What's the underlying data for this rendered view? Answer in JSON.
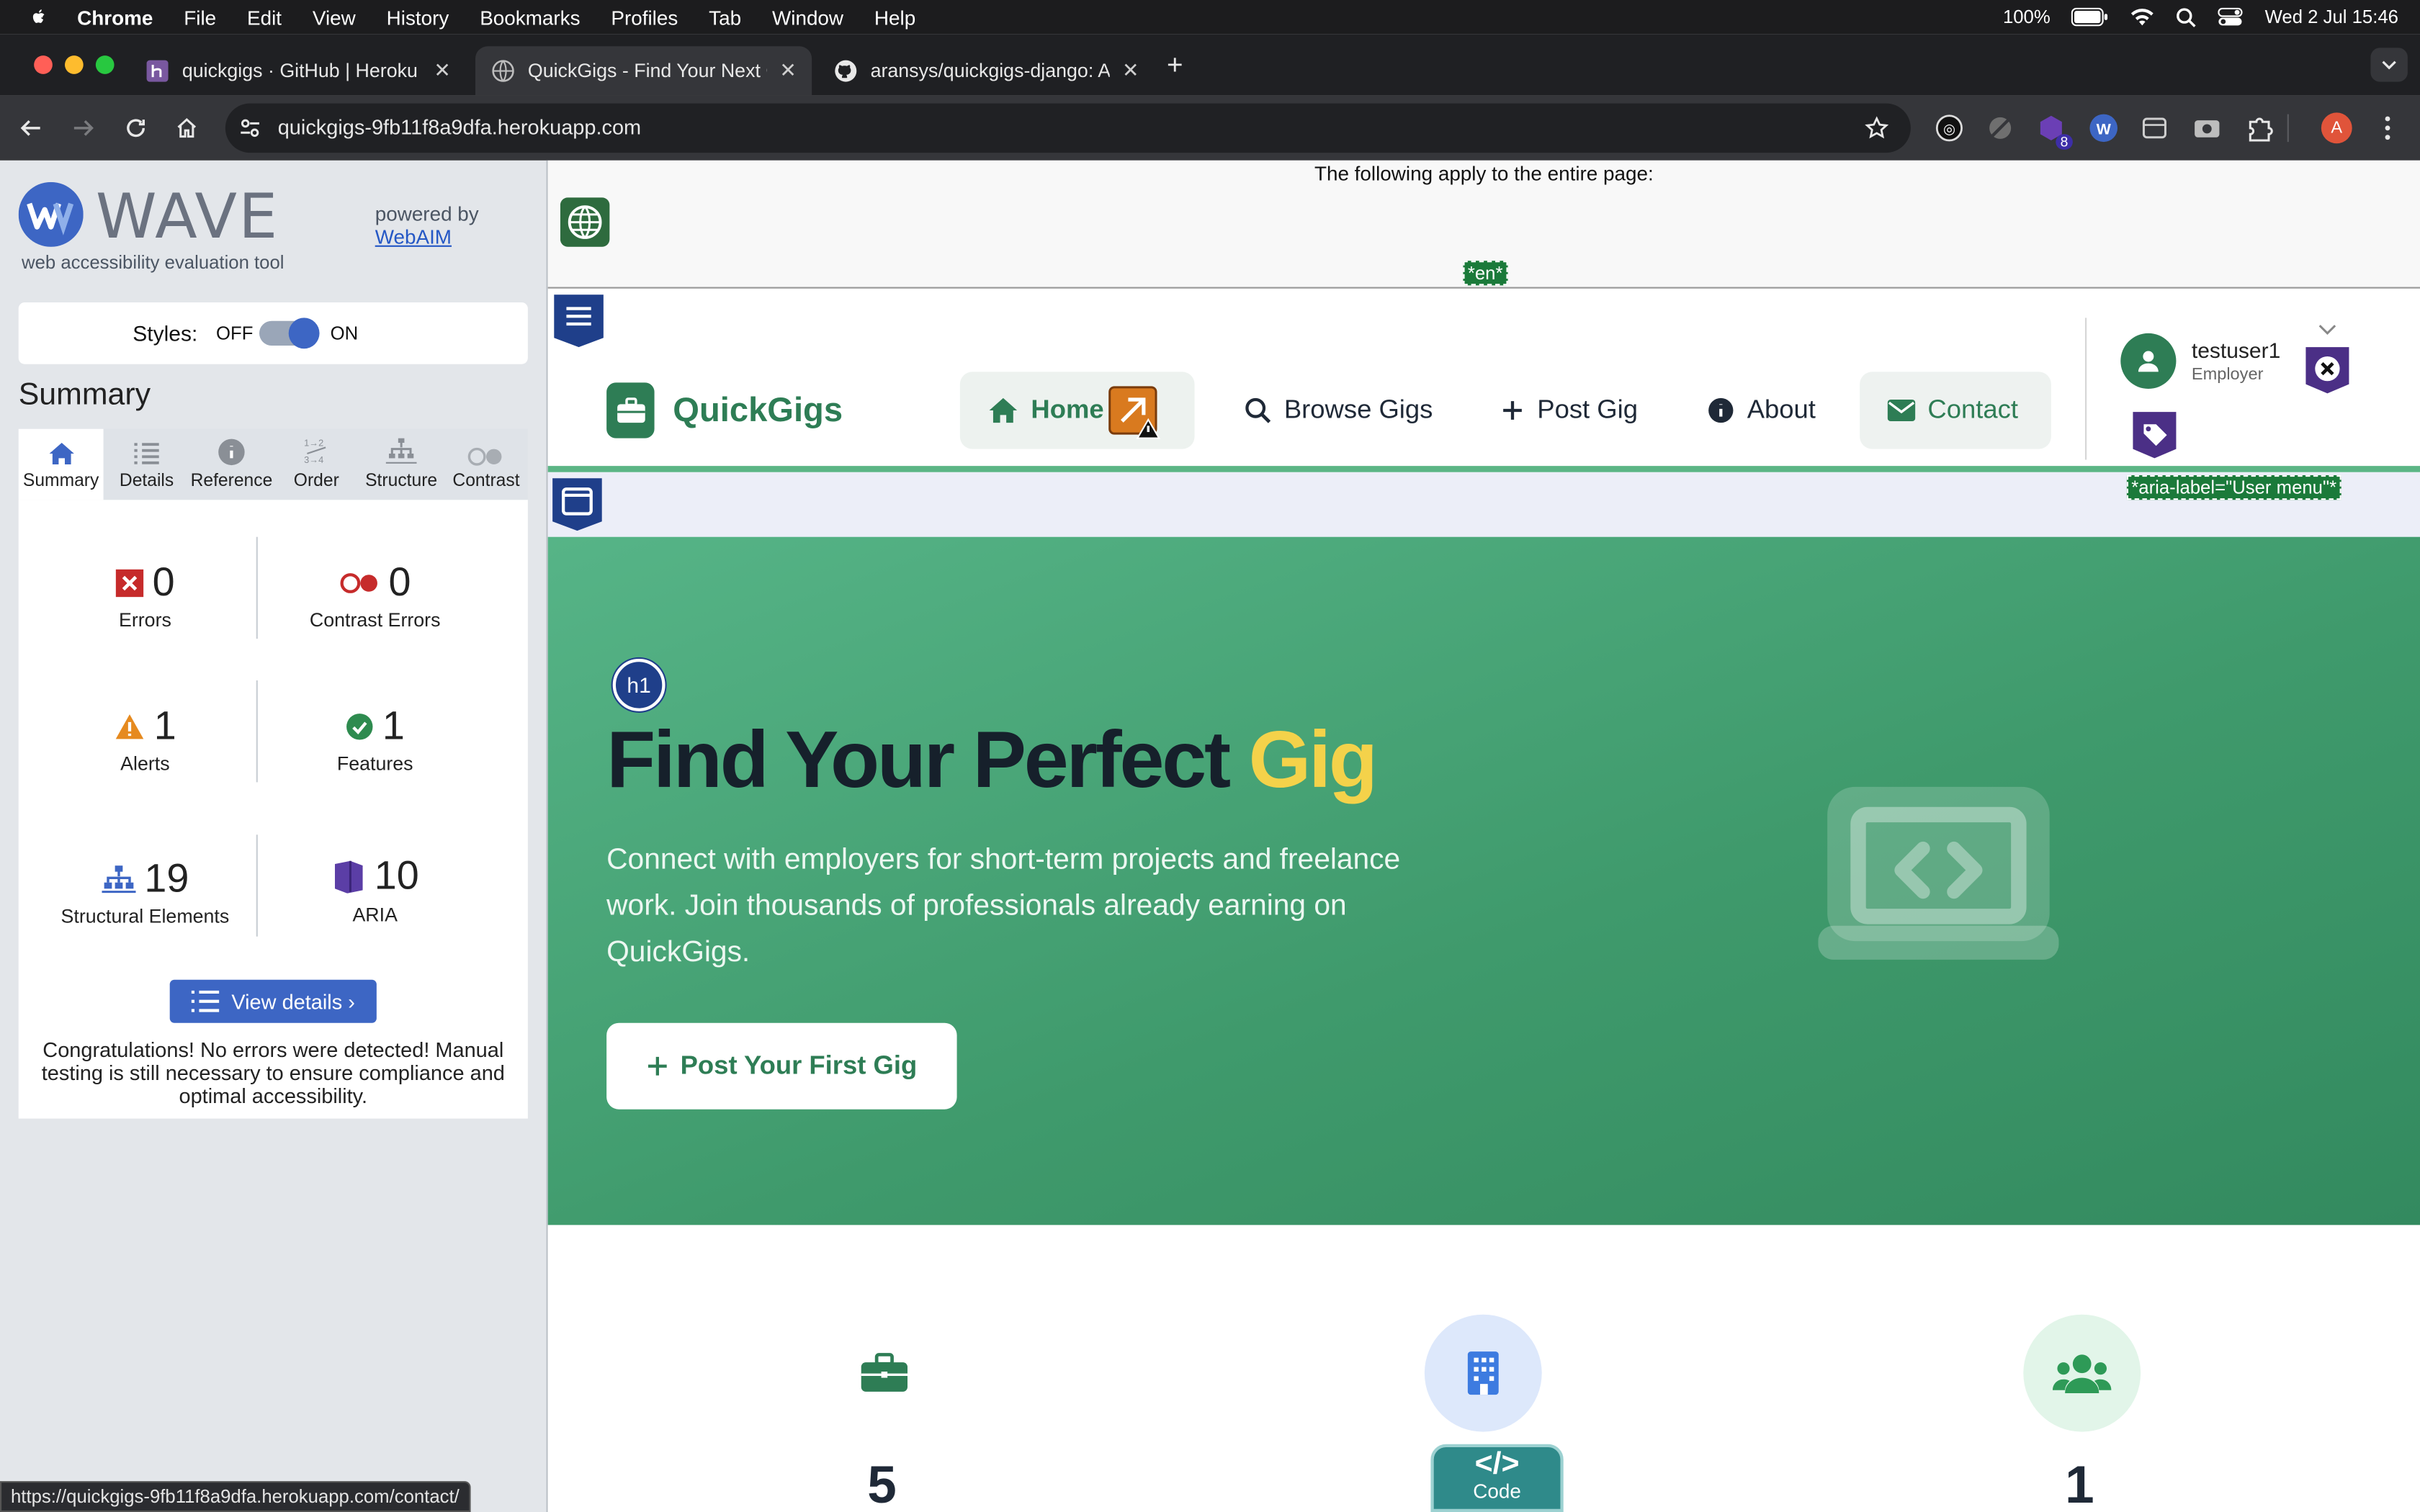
{
  "menubar": {
    "app": "Chrome",
    "items": [
      "File",
      "Edit",
      "View",
      "History",
      "Bookmarks",
      "Profiles",
      "Tab",
      "Window",
      "Help"
    ],
    "battery": "100%",
    "datetime": "Wed 2 Jul  15:46"
  },
  "tabs": [
    {
      "title": "quickgigs · GitHub | Heroku",
      "active": false
    },
    {
      "title": "QuickGigs - Find Your Next G",
      "active": true
    },
    {
      "title": "aransys/quickgigs-django: A",
      "active": false
    }
  ],
  "address": {
    "url": "quickgigs-9fb11f8a9dfa.herokuapp.com"
  },
  "profile_initial": "A",
  "ext_badge": "8",
  "wave": {
    "title": "WAVE",
    "subtitle": "web accessibility evaluation tool",
    "powered_by": "powered by",
    "webaim": "WebAIM",
    "styles_label": "Styles:",
    "styles_off": "OFF",
    "styles_on": "ON",
    "summary_heading": "Summary",
    "tabs": [
      "Summary",
      "Details",
      "Reference",
      "Order",
      "Structure",
      "Contrast"
    ],
    "stats": {
      "errors": {
        "value": "0",
        "label": "Errors"
      },
      "contrast": {
        "value": "0",
        "label": "Contrast Errors"
      },
      "alerts": {
        "value": "1",
        "label": "Alerts"
      },
      "features": {
        "value": "1",
        "label": "Features"
      },
      "structural": {
        "value": "19",
        "label": "Structural Elements"
      },
      "aria": {
        "value": "10",
        "label": "ARIA"
      }
    },
    "view_details": "View details ›",
    "congrats": "Congratulations! No errors were detected! Manual testing is still necessary to ensure compliance and optimal accessibility."
  },
  "status_url": "https://quickgigs-9fb11f8a9dfa.herokuapp.com/contact/",
  "page": {
    "applies_text": "The following apply to the entire page:",
    "lang_tag": "*en*",
    "aria_tag": "*aria-label=\"User menu\"*",
    "brand": "QuickGigs",
    "nav": {
      "home": "Home",
      "browse": "Browse Gigs",
      "post": "Post Gig",
      "about": "About",
      "contact": "Contact"
    },
    "user": {
      "name": "testuser1",
      "role": "Employer"
    },
    "hero": {
      "h1_badge": "h1",
      "title_main": "Find Your Perfect ",
      "title_accent": "Gig",
      "description": "Connect with employers for short-term projects and freelance work. Join thousands of professionals already earning on QuickGigs.",
      "cta": "Post Your First Gig"
    },
    "stats": [
      "5",
      "1"
    ],
    "code_badge": "Code",
    "code_glyph": "</>"
  },
  "colors": {
    "brand_green": "#2e7d55",
    "hero_green": "#3f9a6c",
    "accent_yellow": "#f4d24a",
    "wave_blue": "#3d66c4"
  }
}
